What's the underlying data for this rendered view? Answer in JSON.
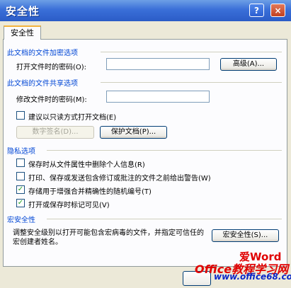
{
  "window": {
    "title": "安全性",
    "help_label": "?",
    "close_label": "×"
  },
  "tab": {
    "label": "安全性"
  },
  "encryption": {
    "section_title": "此文档的文件加密选项",
    "open_password_label": "打开文件时的密码(O):",
    "open_password_value": "",
    "advanced_button": "高级(A)..."
  },
  "sharing": {
    "section_title": "此文档的文件共享选项",
    "modify_password_label": "修改文件时的密码(M):",
    "modify_password_value": "",
    "readonly_label": "建议以只读方式打开文档(E)",
    "readonly_checked": false,
    "digital_signature_button": "数字签名(D)...",
    "protect_document_button": "保护文档(P)..."
  },
  "privacy": {
    "section_title": "隐私选项",
    "options": [
      {
        "label": "保存时从文件属性中删除个人信息(R)",
        "checked": false
      },
      {
        "label": "打印、保存或发送包含修订或批注的文件之前给出警告(W)",
        "checked": false
      },
      {
        "label": "存储用于增强合并精确性的随机编号(T)",
        "checked": true
      },
      {
        "label": "打开或保存时标记可见(V)",
        "checked": true
      }
    ]
  },
  "macro": {
    "section_title": "宏安全性",
    "description": "调整安全级别以打开可能包含宏病毒的文件，并指定可信任的宏创建者姓名。",
    "macro_security_button": "宏安全性(S)..."
  },
  "watermark": {
    "line1": "爱Word",
    "line2": "Office教程学习网",
    "line3": "www.office68.com"
  }
}
